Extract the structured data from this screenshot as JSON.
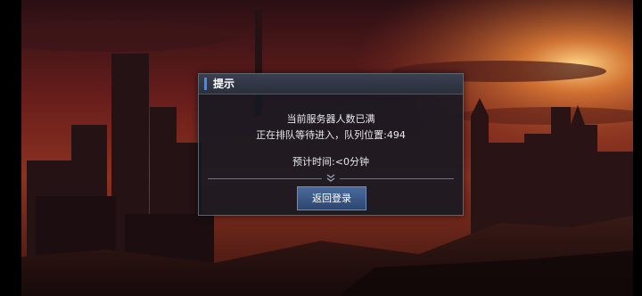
{
  "dialog": {
    "title": "提示",
    "line1": "当前服务器人数已满",
    "line2": "正在排队等待进入，队列位置:494",
    "line3": "预计时间:<0分钟",
    "button_label": "返回登录",
    "divider_icon": "chevron-down-double-icon"
  },
  "colors": {
    "accent": "#3f8df0",
    "button": "#3b5887",
    "panel": "#141822"
  }
}
